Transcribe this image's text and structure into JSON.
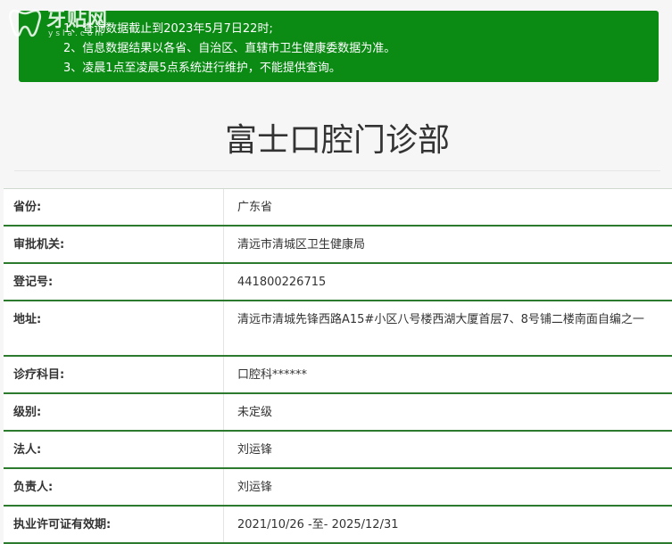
{
  "watermark": {
    "text": "牙贴网",
    "sub": "ysla.com"
  },
  "notice": {
    "lines": [
      "1、查询数据截止到2023年5月7日22时;",
      "2、信息数据结果以各省、自治区、直辖市卫生健康委数据为准。",
      "3、凌晨1点至凌晨5点系统进行维护，不能提供查询。"
    ]
  },
  "clinic": {
    "title": "富士口腔门诊部"
  },
  "details": [
    {
      "label": "省份:",
      "value": "广东省"
    },
    {
      "label": "审批机关:",
      "value": "清远市清城区卫生健康局"
    },
    {
      "label": "登记号:",
      "value": "441800226715"
    },
    {
      "label": "地址:",
      "value": "清远市清城先锋西路A15#小区八号楼西湖大厦首层7、8号铺二楼南面自编之一"
    },
    {
      "label": "诊疗科目:",
      "value": "口腔科******"
    },
    {
      "label": "级别:",
      "value": "未定级"
    },
    {
      "label": "法人:",
      "value": "刘运锋"
    },
    {
      "label": "负责人:",
      "value": "刘运锋"
    },
    {
      "label": "执业许可证有效期:",
      "value": "2021/10/26 -至- 2025/12/31"
    }
  ],
  "colors": {
    "notice_bg": "#0b8a14",
    "row_border": "#2b7a2e",
    "page_bg": "#f6f6f6"
  },
  "icons": {
    "watermark_logo": "tooth-logo-icon"
  }
}
